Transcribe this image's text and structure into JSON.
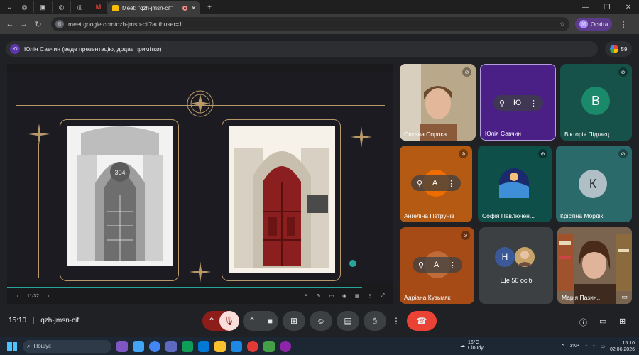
{
  "browser": {
    "active_tab_title": "Meet: \"qzh-jmsn-cif\"",
    "url": "meet.google.com/qzh-jmsn-cif?authuser=1",
    "profile_label": "Освіта",
    "profile_initial": "M"
  },
  "meet": {
    "presenter_initial": "Ю",
    "presenter_banner": "Юлія Савчин (веде презентацію, додає примітки)",
    "participant_count": "59",
    "slide_counter": "11/32",
    "slide_photo_number": "304",
    "meeting_time": "15:10",
    "meeting_code": "qzh-jmsn-cif"
  },
  "participants": [
    {
      "name": "Оксана Сорока",
      "initial": ""
    },
    {
      "name": "Юлія Савчин",
      "initial": "Ю"
    },
    {
      "name": "Вікторія Підгаєц...",
      "initial": "В"
    },
    {
      "name": "Ангеліна Петрунів",
      "initial": "А"
    },
    {
      "name": "Софія Павлючен...",
      "initial": ""
    },
    {
      "name": "Крістіна Мордік",
      "initial": "К"
    },
    {
      "name": "Адріана Кузьмяк",
      "initial": "А"
    },
    {
      "name": "Ще 50 осіб",
      "initial": "Н"
    },
    {
      "name": "Марія Пазин...",
      "initial": ""
    }
  ],
  "taskbar": {
    "search_placeholder": "Пошук",
    "weather_temp": "16°C",
    "weather_text": "Cloudy",
    "lang": "УКР",
    "time": "15:10",
    "date": "02.06.2026"
  },
  "colors": {
    "meet_bg": "#202124",
    "accent_teal": "#26a69a",
    "leave_red": "#ea4335",
    "purple_tile": "#4a1f86",
    "green_tile": "#17524a"
  }
}
